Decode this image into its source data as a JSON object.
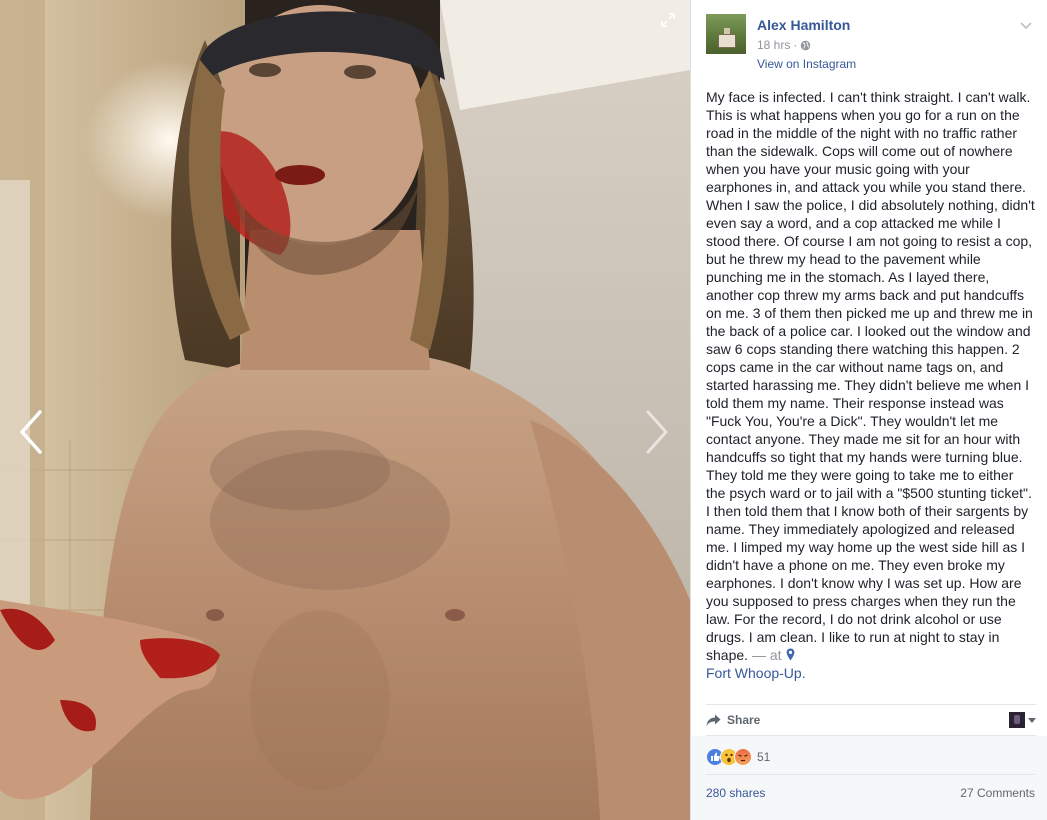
{
  "photo": {
    "alt": "",
    "icons": {
      "prev": "chevron-left-icon",
      "next": "chevron-right-icon",
      "expand": "expand-icon"
    }
  },
  "post": {
    "author": "Alex Hamilton",
    "time": "18 hrs",
    "meta_separator": "·",
    "privacy_icon": "globe-icon",
    "via_link": "View on Instagram",
    "body": "My face is infected. I can't think straight. I can't walk. This is what happens when you go for a run on the road in the middle of the night with no traffic rather than the sidewalk. Cops will come out of nowhere when you have your music going with your earphones in, and attack you while you stand there. When I saw the police, I did absolutely nothing, didn't even say a word, and a cop attacked me while I stood there. Of course I am not going to resist a cop, but he threw my head to the pavement while punching me in the stomach. As I layed there, another cop threw my arms back and put handcuffs on me. 3 of them then picked me up and threw me in the back of a police car. I looked out the window and saw 6 cops standing there watching this happen. 2 cops came in the car without name tags on, and started harassing me. They didn't believe me when I told them my name. Their response instead was \"Fuck You, You're a Dick\". They wouldn't let me contact anyone. They made me sit for an hour with handcuffs so tight that my hands were turning blue. They told me they were going to take me to either the psych ward or to jail with a \"$500 stunting ticket\". I then told them that I know both of their sargents by name. They immediately apologized and released me. I limped my way home up the west side hill as I didn't have a phone on me. They even broke my earphones. I don't know why I was set up. How are you supposed to press charges when they run the law. For the record, I do not drink alcohol or use drugs. I am clean. I like to run at night to stay in shape.",
    "at_text": "— at",
    "place": "Fort Whoop-Up."
  },
  "actions": {
    "share_label": "Share"
  },
  "stats": {
    "reactions": [
      "like",
      "wow",
      "angry"
    ],
    "reaction_count": "51",
    "shares": "280 shares",
    "comments": "27 Comments"
  },
  "colors": {
    "link": "#365899",
    "text": "#1d2129",
    "muted": "#90949c",
    "like": "#4d7fe1",
    "wow": "#f7c33b",
    "angry": "#ec6c47"
  }
}
